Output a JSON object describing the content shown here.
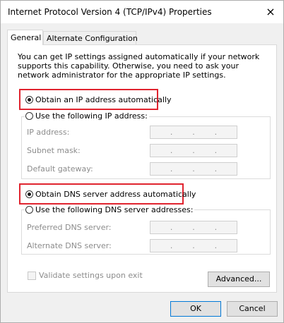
{
  "window": {
    "title": "Internet Protocol Version 4 (TCP/IPv4) Properties",
    "close_icon": "×"
  },
  "tabs": [
    {
      "label": "General",
      "active": true
    },
    {
      "label": "Alternate Configuration",
      "active": false
    }
  ],
  "general": {
    "description": "You can get IP settings assigned automatically if your network supports this capability. Otherwise, you need to ask your network administrator for the appropriate IP settings.",
    "ip_auto_label": "Obtain an IP address automatically",
    "ip_manual_label": "Use the following IP address:",
    "ip_fields": [
      {
        "label": "IP address:",
        "value": ". . ."
      },
      {
        "label": "Subnet mask:",
        "value": ". . ."
      },
      {
        "label": "Default gateway:",
        "value": ". . ."
      }
    ],
    "dns_auto_label": "Obtain DNS server address automatically",
    "dns_manual_label": "Use the following DNS server addresses:",
    "dns_fields": [
      {
        "label": "Preferred DNS server:",
        "value": ". . ."
      },
      {
        "label": "Alternate DNS server:",
        "value": ". . ."
      }
    ],
    "validate_label": "Validate settings upon exit",
    "advanced_label": "Advanced..."
  },
  "footer": {
    "ok_label": "OK",
    "cancel_label": "Cancel"
  },
  "colors": {
    "highlight": "#e0242f",
    "default_button_border": "#0078d7"
  }
}
